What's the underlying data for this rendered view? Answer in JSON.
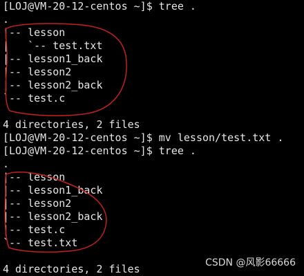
{
  "terminal": {
    "lines": [
      "[LOJ@VM-20-12-centos ~]$ tree .",
      ".",
      "|-- lesson",
      "|   `-- test.txt",
      "|-- lesson1_back",
      "|-- lesson2",
      "|-- lesson2_back",
      "`-- test.c",
      "",
      "4 directories, 2 files",
      "[LOJ@VM-20-12-centos ~]$ mv lesson/test.txt .",
      "[LOJ@VM-20-12-centos ~]$ tree .",
      ".",
      "|-- lesson",
      "|-- lesson1_back",
      "|-- lesson2",
      "|-- lesson2_back",
      "|-- test.c",
      "`-- test.txt",
      "",
      "4 directories, 2 files"
    ]
  },
  "annotations": {
    "color": "#c42020"
  },
  "watermark": {
    "text": "CSDN @风影66666"
  }
}
